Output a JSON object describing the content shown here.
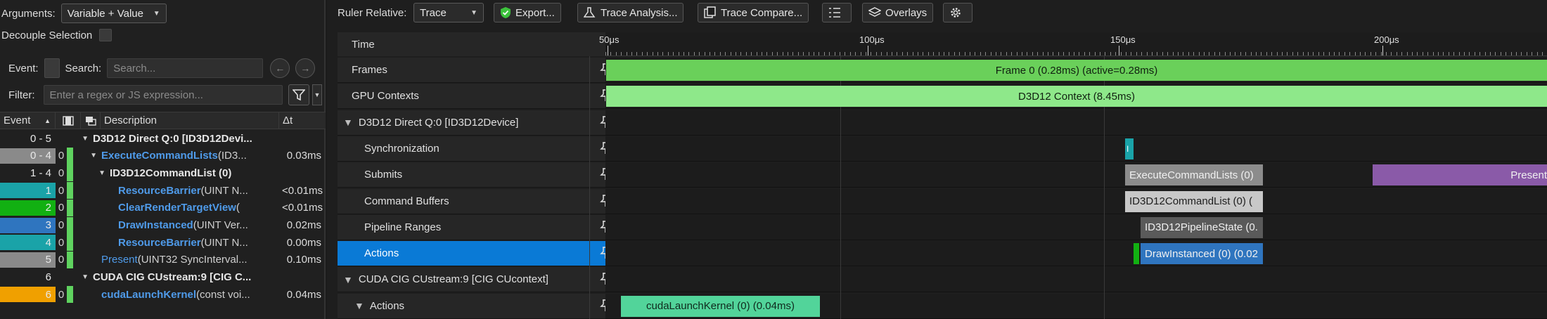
{
  "left": {
    "arguments_label": "Arguments:",
    "arguments_value": "Variable + Value",
    "decouple_label": "Decouple Selection",
    "event_label": "Event:",
    "search_label": "Search:",
    "search_placeholder": "Search...",
    "filter_label": "Filter:",
    "filter_placeholder": "Enter a regex or JS expression...",
    "columns": {
      "event": "Event",
      "description": "Description",
      "dt": "Δt"
    },
    "rows": [
      {
        "event": "0 - 5",
        "b": "",
        "desc_bold": "D3D12 Direct Q:0 [ID3D12Devi...",
        "fn": "",
        "args": "",
        "dt": "",
        "ev_color": "",
        "bar": false,
        "indent": 1
      },
      {
        "event": "0 - 4",
        "b": "0",
        "desc_bold": "",
        "fn": "ExecuteCommandLists",
        "args": "(ID3...",
        "dt": "0.03ms",
        "ev_color": "#8a8a8a",
        "bar": true,
        "indent": 2
      },
      {
        "event": "1 - 4",
        "b": "0",
        "desc_bold": "ID3D12CommandList (0)",
        "fn": "",
        "args": "",
        "dt": "",
        "ev_color": "",
        "bar": true,
        "indent": 3
      },
      {
        "event": "1",
        "b": "0",
        "desc_bold": "",
        "fn": "ResourceBarrier",
        "args": "(UINT N...",
        "dt": "<0.01ms",
        "ev_color": "#1aa3a8",
        "bar": true,
        "indent": 4
      },
      {
        "event": "2",
        "b": "0",
        "desc_bold": "",
        "fn": "ClearRenderTargetView",
        "args": "(",
        "dt": "<0.01ms",
        "ev_color": "#12b012",
        "bar": true,
        "indent": 4
      },
      {
        "event": "3",
        "b": "0",
        "desc_bold": "",
        "fn": "DrawInstanced",
        "args": "(UINT Ver...",
        "dt": "0.02ms",
        "ev_color": "#2f75bf",
        "bar": true,
        "indent": 4
      },
      {
        "event": "4",
        "b": "0",
        "desc_bold": "",
        "fn": "ResourceBarrier",
        "args": "(UINT N...",
        "dt": "0.00ms",
        "ev_color": "#1aa3a8",
        "bar": true,
        "indent": 4
      },
      {
        "event": "5",
        "b": "0",
        "desc_bold": "",
        "fn": "Present",
        "args": "(UINT32 SyncInterval...",
        "dt": "0.10ms",
        "ev_color": "#8a8a8a",
        "bar": true,
        "indent": 2
      },
      {
        "event": "6",
        "b": "",
        "desc_bold": "CUDA CIG CUstream:9 [CIG C...",
        "fn": "",
        "args": "",
        "dt": "",
        "ev_color": "",
        "bar": false,
        "indent": 1
      },
      {
        "event": "6",
        "b": "0",
        "desc_bold": "",
        "fn": "cudaLaunchKernel",
        "args": "(const voi...",
        "dt": "0.04ms",
        "ev_color": "#f0a000",
        "bar": true,
        "indent": 2
      }
    ]
  },
  "toolbar": {
    "ruler_label": "Ruler Relative:",
    "ruler_value": "Trace",
    "export": "Export...",
    "trace_analysis": "Trace Analysis...",
    "trace_compare": "Trace Compare...",
    "overlays": "Overlays"
  },
  "timeline": {
    "time_label": "Time",
    "ticks": [
      "50μs",
      "100μs",
      "150μs",
      "200μs"
    ],
    "lanes": [
      {
        "label": "Frames"
      },
      {
        "label": "GPU Contexts"
      },
      {
        "label": "D3D12 Direct Q:0 [ID3D12Device]"
      },
      {
        "label": "Synchronization"
      },
      {
        "label": "Submits"
      },
      {
        "label": "Command Buffers"
      },
      {
        "label": "Pipeline Ranges"
      },
      {
        "label": "Actions"
      },
      {
        "label": "CUDA CIG CUstream:9 [CIG CUcontext]"
      },
      {
        "label": "Actions"
      }
    ],
    "events": {
      "frame": "Frame 0 (0.28ms) (active=0.28ms)",
      "d3d_context": "D3D12 Context (8.45ms)",
      "sync_marker": "I",
      "execute": "ExecuteCommandLists (0)",
      "present": "Present",
      "cmdlist": "ID3D12CommandList (0) (",
      "pipeline": "ID3D12PipelineState (0.",
      "draw": "DrawInstanced (0) (0.02",
      "cuda": "cudaLaunchKernel (0) (0.04ms)"
    }
  },
  "colors": {
    "frame_green": "#6ad05a",
    "context_green": "#8ee88a",
    "selection_blue": "#0a7ad6",
    "present_purple": "#8a5aa8",
    "cuda_green": "#52d49a"
  },
  "icons": [
    "filter-icon",
    "shield-icon",
    "trace-analysis-icon",
    "trace-compare-icon",
    "list-icon",
    "layers-icon",
    "gear-icon",
    "pin-icon",
    "chevron-down-icon",
    "arrow-left-icon",
    "arrow-right-icon"
  ]
}
